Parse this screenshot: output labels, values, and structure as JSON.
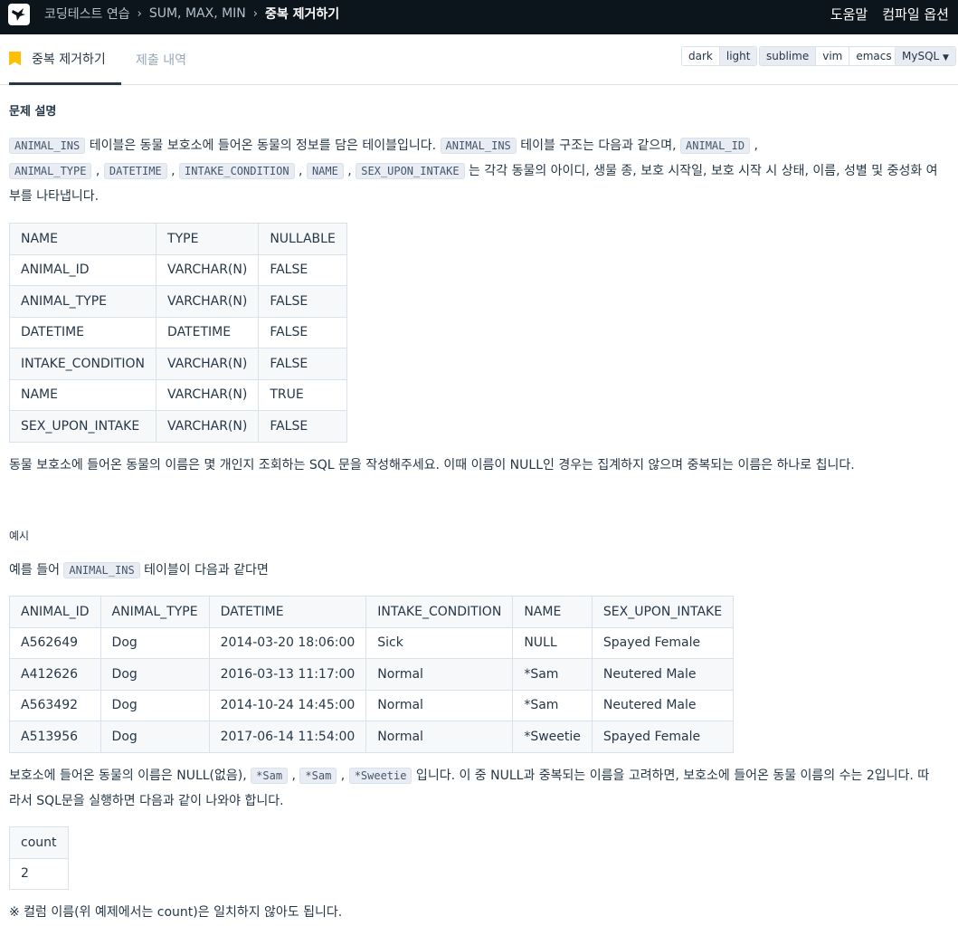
{
  "nav": {
    "breadcrumb": [
      "코딩테스트 연습",
      "SUM, MAX, MIN",
      "중복 제거하기"
    ],
    "help": "도움말",
    "compile_options": "컴파일 옵션"
  },
  "tabs": {
    "active": "중복 제거하기",
    "inactive": "제출 내역"
  },
  "theme_buttons": [
    "dark",
    "light"
  ],
  "editor_buttons": [
    "sublime",
    "vim",
    "emacs"
  ],
  "language_select": "MySQL",
  "problem": {
    "heading": "문제 설명",
    "intro": {
      "c1": "ANIMAL_INS",
      "t1": " 테이블은 동물 보호소에 들어온 동물의 정보를 담은 테이블입니다. ",
      "c2": "ANIMAL_INS",
      "t2": " 테이블 구조는 다음과 같으며, ",
      "c3": "ANIMAL_ID",
      "t3": " ,",
      "c4": "ANIMAL_TYPE",
      "sep": " , ",
      "c5": "DATETIME",
      "c6": "INTAKE_CONDITION",
      "c7": "NAME",
      "c8": "SEX_UPON_INTAKE",
      "t4": " 는 각각 동물의 아이디, 생물 종, 보호 시작일, 보호 시작 시 상태, 이름, 성별 및 중성화 여부를 나타냅니다."
    },
    "schema_table": [
      [
        "NAME",
        "TYPE",
        "NULLABLE"
      ],
      [
        "ANIMAL_ID",
        "VARCHAR(N)",
        "FALSE"
      ],
      [
        "ANIMAL_TYPE",
        "VARCHAR(N)",
        "FALSE"
      ],
      [
        "DATETIME",
        "DATETIME",
        "FALSE"
      ],
      [
        "INTAKE_CONDITION",
        "VARCHAR(N)",
        "FALSE"
      ],
      [
        "NAME",
        "VARCHAR(N)",
        "TRUE"
      ],
      [
        "SEX_UPON_INTAKE",
        "VARCHAR(N)",
        "FALSE"
      ]
    ],
    "question": "동물 보호소에 들어온 동물의 이름은 몇 개인지 조회하는 SQL 문을 작성해주세요. 이때 이름이 NULL인 경우는 집계하지 않으며 중복되는 이름은 하나로 칩니다.",
    "example_heading": "예시",
    "example_intro": {
      "t1": "예를 들어 ",
      "c1": "ANIMAL_INS",
      "t2": " 테이블이 다음과 같다면"
    },
    "example_table": [
      [
        "ANIMAL_ID",
        "ANIMAL_TYPE",
        "DATETIME",
        "INTAKE_CONDITION",
        "NAME",
        "SEX_UPON_INTAKE"
      ],
      [
        "A562649",
        "Dog",
        "2014-03-20 18:06:00",
        "Sick",
        "NULL",
        "Spayed Female"
      ],
      [
        "A412626",
        "Dog",
        "2016-03-13 11:17:00",
        "Normal",
        "*Sam",
        "Neutered Male"
      ],
      [
        "A563492",
        "Dog",
        "2014-10-24 14:45:00",
        "Normal",
        "*Sam",
        "Neutered Male"
      ],
      [
        "A513956",
        "Dog",
        "2017-06-14 11:54:00",
        "Normal",
        "*Sweetie",
        "Spayed Female"
      ]
    ],
    "explanation": {
      "t1": "보호소에 들어온 동물의 이름은 NULL(없음), ",
      "c1": "*Sam",
      "sep": " , ",
      "c2": "*Sam",
      "c3": "*Sweetie",
      "t2": " 입니다. 이 중 NULL과 중복되는 이름을 고려하면, 보호소에 들어온 동물 이름의 수는 2입니다. 따라서 SQL문을 실행하면 다음과 같이 나와야 합니다."
    },
    "result_table": [
      [
        "count"
      ],
      [
        "2"
      ]
    ],
    "note": "※ 컬럼 이름(위 예제에서는 count)은 일치하지 않아도 됩니다."
  }
}
